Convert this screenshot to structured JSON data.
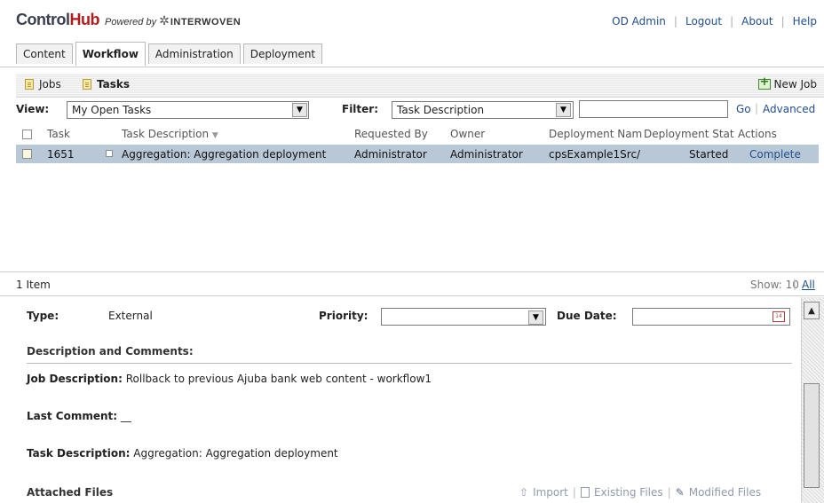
{
  "header": {
    "logo_control": "Control",
    "logo_hub": "Hub",
    "powered_by": "Powered by",
    "brand": "INTERWOVEN",
    "links": [
      "OD Admin",
      "Logout",
      "About",
      "Help"
    ]
  },
  "tabs": [
    {
      "label": "Content",
      "active": false
    },
    {
      "label": "Workflow",
      "active": true
    },
    {
      "label": "Administration",
      "active": false
    },
    {
      "label": "Deployment",
      "active": false
    }
  ],
  "subnav": {
    "jobs": "Jobs",
    "tasks": "Tasks",
    "new_job": "New Job"
  },
  "filters": {
    "view_label": "View:",
    "view_value": "My Open Tasks",
    "filter_label": "Filter:",
    "filter_value": "Task Description",
    "search_value": "",
    "go": "Go",
    "advanced": "Advanced"
  },
  "table": {
    "headers": [
      "Task",
      "Task Description",
      "Requested By",
      "Owner",
      "Deployment Nam",
      "Deployment Stat",
      "Actions"
    ],
    "sort_indicator": "▼",
    "rows": [
      {
        "task": "1651",
        "description": "Aggregation: Aggregation deployment",
        "requested_by": "Administrator",
        "owner": "Administrator",
        "deployment_name": "cpsExample1Src/",
        "deployment_status": "Started",
        "action": "Complete"
      }
    ]
  },
  "list_footer": {
    "count": "1 Item",
    "show_label": "Show: 10",
    "all": "All"
  },
  "detail": {
    "type_label": "Type:",
    "type_value": "External",
    "priority_label": "Priority:",
    "priority_value": "",
    "due_label": "Due Date:",
    "due_value": "",
    "calendar_day": "14",
    "desc_header": "Description and Comments:",
    "job_desc_label": "Job Description:",
    "job_desc_value": "Rollback to previous Ajuba bank web content - workflow1",
    "last_comment_label": "Last Comment:",
    "last_comment_value": "__",
    "task_desc_label": "Task Description:",
    "task_desc_value": "Aggregation: Aggregation deployment",
    "attached_files": "Attached Files",
    "import": "Import",
    "existing_files": "Existing Files",
    "modified_files": "Modified Files"
  },
  "colors": {
    "selected_row": "#b9c8d7",
    "link": "#1f4e8c",
    "logo_hub": "#b21b1b"
  }
}
